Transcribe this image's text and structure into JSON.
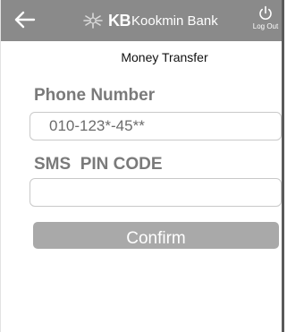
{
  "header": {
    "back_icon": "arrow-left-icon",
    "brand_logo": "kb-star-logo",
    "brand_kb": "KB",
    "brand_name": "Kookmin Bank",
    "logout_icon": "power-icon",
    "logout_label": "Log Out"
  },
  "page": {
    "title": "Money Transfer"
  },
  "form": {
    "phone_label": "Phone Number",
    "phone_value": "010-123*-45**",
    "pin_label": "SMS  PIN CODE",
    "pin_value": "",
    "confirm_label": "Confirm"
  },
  "colors": {
    "header_bg": "#8a8a8a",
    "label_text": "#7a7a7a",
    "button_bg": "#a9a9a9",
    "input_border": "#c9c9c9"
  }
}
